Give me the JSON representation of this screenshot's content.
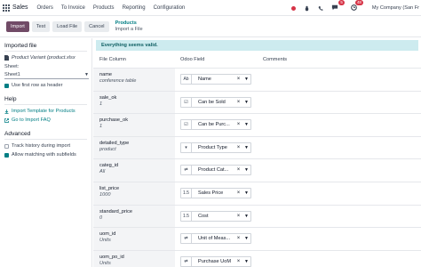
{
  "navbar": {
    "brand": "Sales",
    "menu": [
      "Orders",
      "To Invoice",
      "Products",
      "Reporting",
      "Configuration"
    ],
    "messages_count": "5",
    "activities_count": "48",
    "company": "My Company (San Fr"
  },
  "control": {
    "buttons": {
      "import": "Import",
      "test": "Test",
      "load_file": "Load File",
      "cancel": "Cancel"
    },
    "breadcrumb_link": "Products",
    "breadcrumb_current": "Import a File"
  },
  "sidebar": {
    "imported_file_heading": "Imported file",
    "file_name": "Product Variant (product.xlsx",
    "sheet_label": "Sheet:",
    "sheet_value": "Sheet1",
    "first_row_header": "Use first row as header",
    "help_heading": "Help",
    "import_template": "Import Template for Products",
    "faq": "Go to Import FAQ",
    "advanced_heading": "Advanced",
    "track_history": "Track history during import",
    "allow_matching": "Allow matching with subfields"
  },
  "alert": "Everything seems valid.",
  "columns": {
    "file": "File Column",
    "odoo": "Odoo Field",
    "comments": "Comments"
  },
  "rows": [
    {
      "name": "name",
      "sample": "conference table",
      "icon": "Ab",
      "field": "Name"
    },
    {
      "name": "sale_ok",
      "sample": "1",
      "icon": "☑",
      "field": "Can be Sold"
    },
    {
      "name": "purchase_ok",
      "sample": "1",
      "icon": "☑",
      "field": "Can be Purc..."
    },
    {
      "name": "detailed_type",
      "sample": "product",
      "icon": "▾",
      "field": "Product Type"
    },
    {
      "name": "categ_id",
      "sample": "All",
      "icon": "⇄",
      "field": "Product Cat..."
    },
    {
      "name": "list_price",
      "sample": "1000",
      "icon": "1.5",
      "field": "Sales Price"
    },
    {
      "name": "standard_price",
      "sample": "0",
      "icon": "1.5",
      "field": "Cost"
    },
    {
      "name": "uom_id",
      "sample": "Units",
      "icon": "⇄",
      "field": "Unit of Meas..."
    },
    {
      "name": "uom_po_id",
      "sample": "Units",
      "icon": "⇄",
      "field": "Purchase UoM"
    }
  ]
}
